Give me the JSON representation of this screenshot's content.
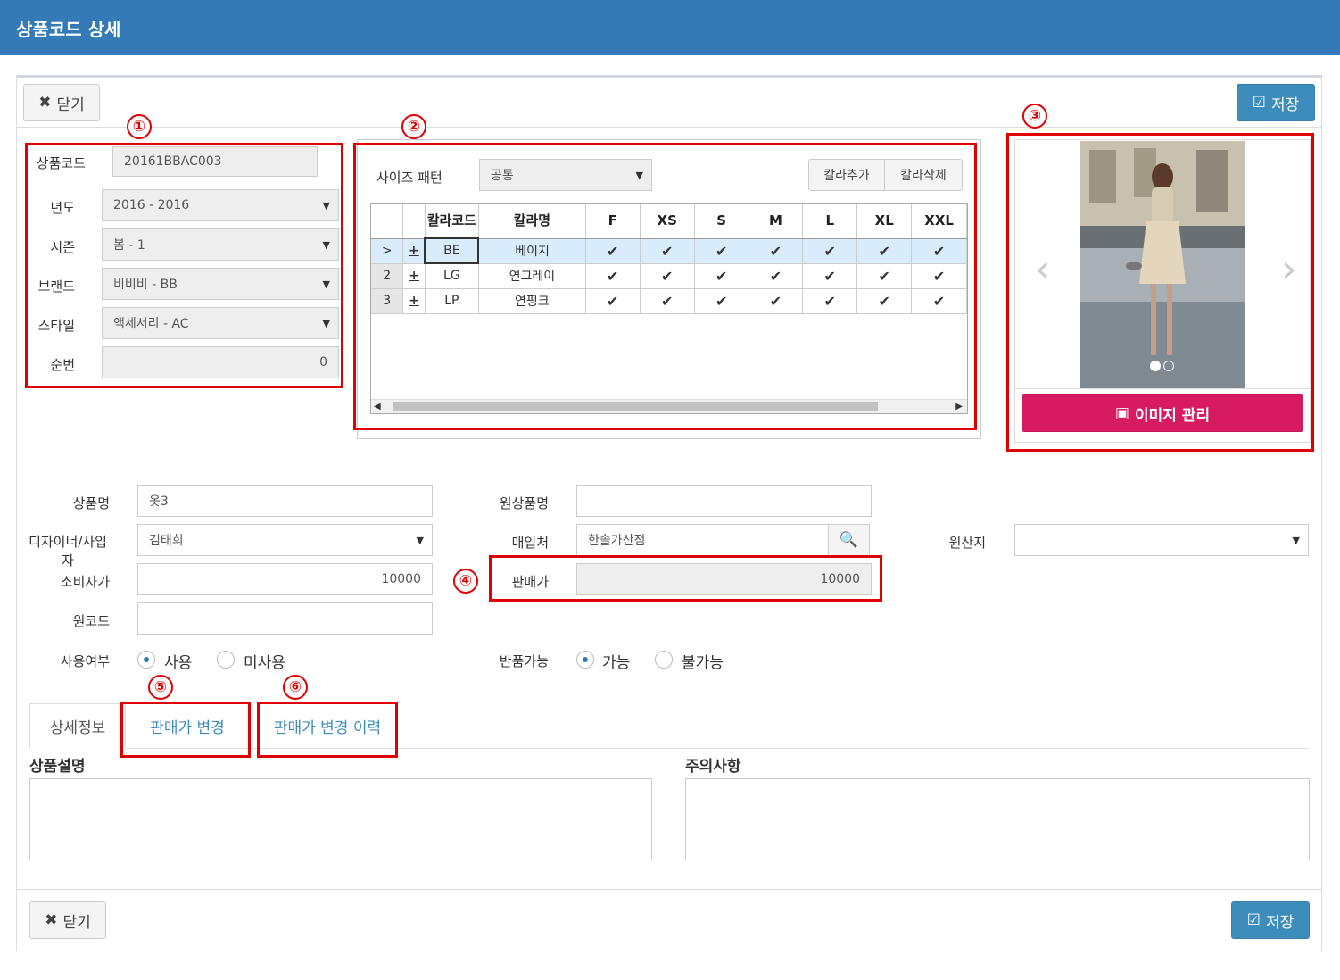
{
  "title": "상품코드 상세",
  "toolbar": {
    "close_label": "닫기",
    "save_label": "저장"
  },
  "markers": [
    "①",
    "②",
    "③",
    "④",
    "⑤",
    "⑥"
  ],
  "basic": {
    "code_label": "상품코드",
    "code_value": "20161BBAC003",
    "year_label": "년도",
    "year_value": "2016 - 2016",
    "season_label": "시즌",
    "season_value": "봄 - 1",
    "brand_label": "브랜드",
    "brand_value": "비비비 - BB",
    "style_label": "스타일",
    "style_value": "액세서리 - AC",
    "seq_label": "순번",
    "seq_value": "0"
  },
  "color_grid": {
    "pattern_label": "사이즈 패턴",
    "pattern_value": "공통",
    "add_color": "칼라추가",
    "del_color": "칼라삭제",
    "headers": {
      "code": "칼라코드",
      "name": "칼라명"
    },
    "sizes": [
      "F",
      "XS",
      "S",
      "M",
      "L",
      "XL",
      "XXL"
    ],
    "rows": [
      {
        "idx": ">",
        "code": "BE",
        "name": "베이지",
        "checks": [
          "✔",
          "✔",
          "✔",
          "✔",
          "✔",
          "✔",
          "✔"
        ]
      },
      {
        "idx": "2",
        "code": "LG",
        "name": "연그레이",
        "checks": [
          "✔",
          "✔",
          "✔",
          "✔",
          "✔",
          "✔",
          "✔"
        ]
      },
      {
        "idx": "3",
        "code": "LP",
        "name": "연핑크",
        "checks": [
          "✔",
          "✔",
          "✔",
          "✔",
          "✔",
          "✔",
          "✔"
        ]
      }
    ],
    "plus": "+"
  },
  "image_panel": {
    "manage_label": "이미지 관리",
    "prev": "‹",
    "next": "›"
  },
  "details": {
    "name_label": "상품명",
    "name_value": "옷3",
    "orig_name_label": "원상품명",
    "orig_name_value": "",
    "designer_label": "디자이너/사입자",
    "designer_value": "김태희",
    "buy_label": "매입처",
    "buy_value": "한솔가산점",
    "origin_label": "원산지",
    "origin_value": "",
    "consumer_label": "소비자가",
    "consumer_value": "10000",
    "sale_label": "판매가",
    "sale_value": "10000",
    "orig_code_label": "원코드",
    "orig_code_value": "",
    "use_label": "사용여부",
    "use_yes": "사용",
    "use_no": "미사용",
    "return_label": "반품가능",
    "return_yes": "가능",
    "return_no": "불가능"
  },
  "tabs": [
    "상세정보",
    "판매가 변경",
    "판매가 변경 이력"
  ],
  "desc": {
    "product_desc_label": "상품설명",
    "caution_label": "주의사항"
  }
}
